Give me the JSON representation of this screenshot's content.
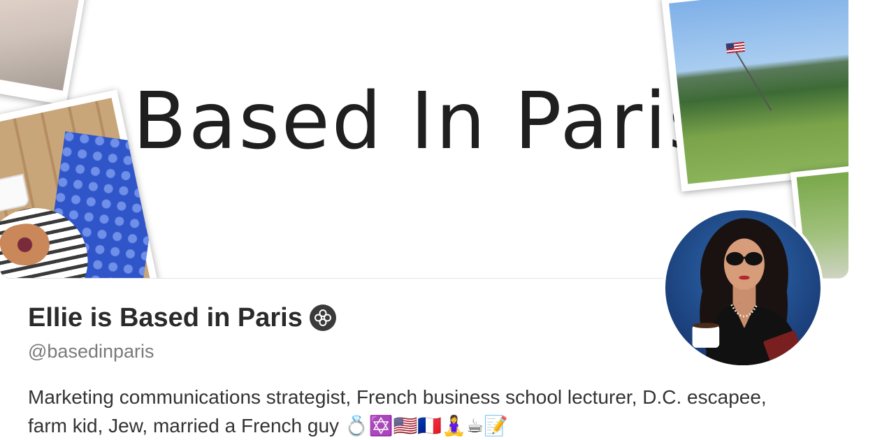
{
  "banner": {
    "title": "Based In Paris"
  },
  "profile": {
    "display_name": "Ellie is Based in Paris",
    "handle": "@basedinparis",
    "bio": "Marketing communications strategist, French business school lecturer, D.C. escapee, farm kid, Jew, married a French guy 💍✡️🇺🇸🇫🇷🧘‍♀️☕📝",
    "badge_icon": "flower-badge-icon"
  },
  "colors": {
    "text_primary": "#2a2a2a",
    "text_secondary": "#7a7a7a",
    "avatar_bg": "#1b3f7a"
  }
}
